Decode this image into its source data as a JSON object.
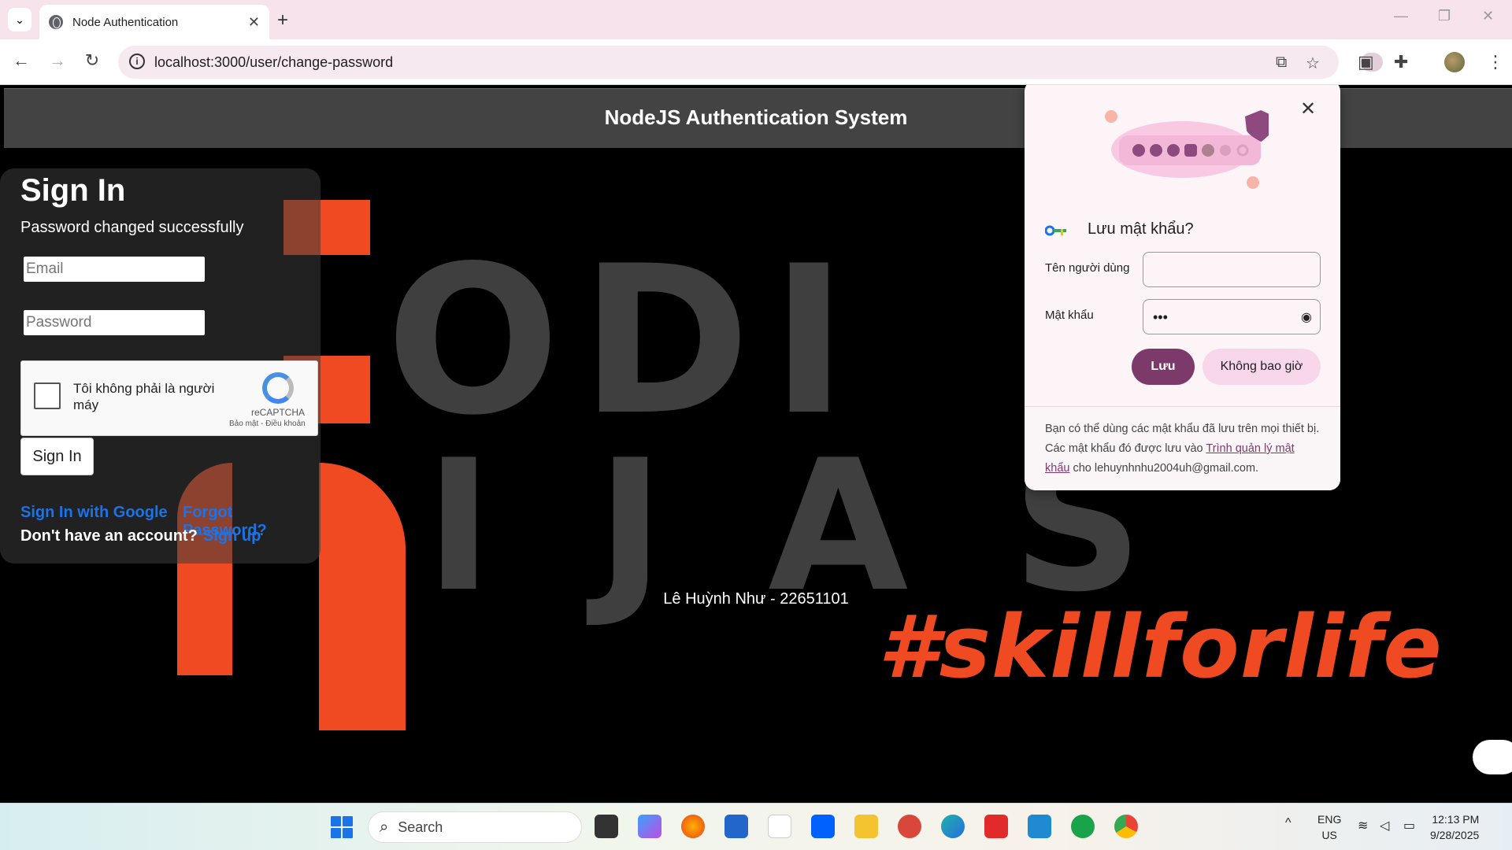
{
  "browser": {
    "tab_title": "Node Authentication",
    "url": "localhost:3000/user/change-password"
  },
  "site": {
    "header_title": "NodeJS Authentication System",
    "footer_text": "Lê Huỳnh Như - 22651101",
    "background_slogan": "#skillforlife"
  },
  "signin": {
    "title": "Sign In",
    "message": "Password changed successfully",
    "email_placeholder": "Email",
    "password_placeholder": "Password",
    "recaptcha_label": "Tôi không phải là người máy",
    "recaptcha_brand": "reCAPTCHA",
    "recaptcha_terms": "Bảo mật - Điều khoản",
    "button": "Sign In",
    "google_link": "Sign In with Google",
    "forgot_link": "Forgot Password?",
    "no_account": "Don't have an account?",
    "signup_link": "Sign up"
  },
  "password_popup": {
    "title": "Lưu mật khẩu?",
    "username_label": "Tên người dùng",
    "username_value": "",
    "password_label": "Mật khẩu",
    "password_value": "•••",
    "save_button": "Lưu",
    "never_button": "Không bao giờ",
    "footer_prefix": "Bạn có thể dùng các mật khẩu đã lưu trên mọi thiết bị. Các mật khẩu đó được lưu vào ",
    "footer_link": "Trình quản lý mật khẩu",
    "footer_suffix": " cho lehuynhnhu2004uh@gmail.com."
  },
  "taskbar": {
    "search_placeholder": "Search",
    "lang_top": "ENG",
    "lang_bottom": "US",
    "time": "12:13 PM",
    "date": "9/28/2025"
  },
  "colors": {
    "accent_orange": "#f04a22",
    "link_blue": "#1a73e8",
    "save_purple": "#7c3a6a"
  }
}
